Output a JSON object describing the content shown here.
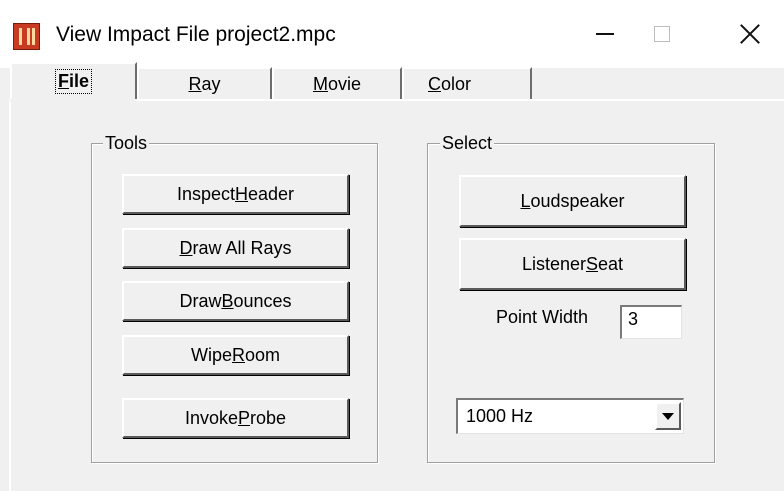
{
  "window": {
    "title": "View Impact File project2.mpc"
  },
  "tabs": [
    {
      "pre": "",
      "key": "F",
      "post": "ile"
    },
    {
      "pre": "",
      "key": "R",
      "post": "ay"
    },
    {
      "pre": "",
      "key": "M",
      "post": "ovie"
    },
    {
      "pre": "",
      "key": "C",
      "post": "olor"
    }
  ],
  "tools": {
    "label": "Tools",
    "buttons": [
      {
        "pre": "Inspect ",
        "key": "H",
        "post": "eader"
      },
      {
        "pre": "",
        "key": "D",
        "post": "raw All Rays"
      },
      {
        "pre": "Draw ",
        "key": "B",
        "post": "ounces"
      },
      {
        "pre": "Wipe ",
        "key": "R",
        "post": "oom"
      },
      {
        "pre": "Invoke ",
        "key": "P",
        "post": "robe"
      }
    ]
  },
  "select": {
    "label": "Select",
    "loudspeaker": {
      "pre": "",
      "key": "L",
      "post": "oudspeaker"
    },
    "listener": {
      "pre": "Listener ",
      "key": "S",
      "post": "eat"
    },
    "point_width_label": "Point Width",
    "point_width_value": "3",
    "frequency_value": "1000 Hz"
  }
}
